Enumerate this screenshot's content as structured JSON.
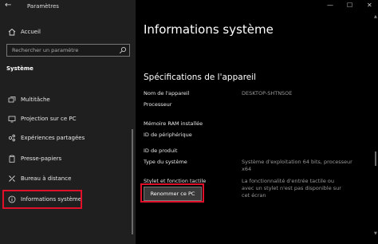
{
  "window": {
    "title": "Paramètres",
    "back_glyph": "←",
    "minimize_glyph": "—",
    "maximize_glyph": "☐",
    "close_glyph": "✕"
  },
  "sidebar": {
    "home_label": "Accueil",
    "search_placeholder": "Rechercher un paramètre",
    "section_label": "Système",
    "items": [
      {
        "label": "Multitâche",
        "icon": "multitasking-icon"
      },
      {
        "label": "Projection sur ce PC",
        "icon": "projection-icon"
      },
      {
        "label": "Expériences partagées",
        "icon": "shared-experiences-icon"
      },
      {
        "label": "Presse-papiers",
        "icon": "clipboard-icon"
      },
      {
        "label": "Bureau à distance",
        "icon": "remote-desktop-icon"
      },
      {
        "label": "Informations système",
        "icon": "info-icon"
      }
    ]
  },
  "main": {
    "title": "Informations système",
    "section_title": "Spécifications de l'appareil",
    "specs": [
      {
        "label": "Nom de l'appareil",
        "value": "DESKTOP-SHTNSOE"
      },
      {
        "label": "Processeur",
        "value": ""
      },
      {
        "label": "Mémoire RAM installée",
        "value": ""
      },
      {
        "label": "ID de périphérique",
        "value": ""
      },
      {
        "label": "ID de produit",
        "value": ""
      },
      {
        "label": "Type du système",
        "value": "Système d'exploitation 64 bits, processeur x64"
      },
      {
        "label": "Stylet et fonction tactile",
        "value": "La fonctionnalité d'entrée tactile ou avec un stylet n'est pas disponible sur cet écran"
      }
    ],
    "rename_button": "Renommer ce PC"
  },
  "colors": {
    "highlight_border": "#e0102a",
    "sidebar_bg": "#1f1f1f",
    "main_bg": "#000000"
  }
}
